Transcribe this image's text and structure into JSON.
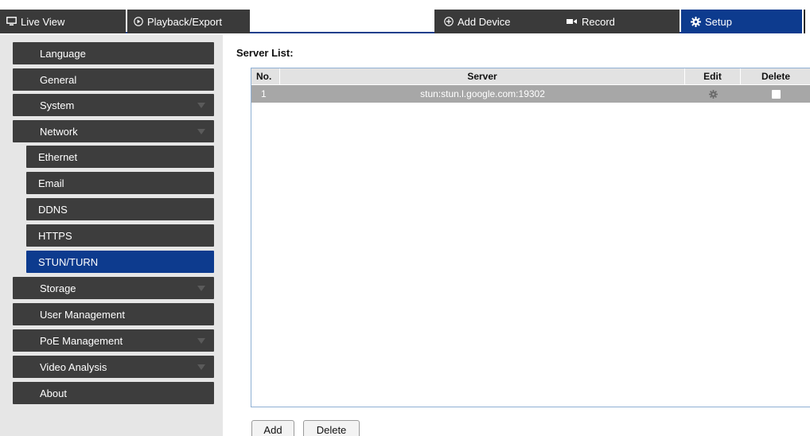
{
  "nav": {
    "live_view": "Live View",
    "playback": "Playback/Export",
    "add_device": "Add Device",
    "record": "Record",
    "setup": "Setup"
  },
  "sidebar": {
    "items": [
      {
        "label": "Language"
      },
      {
        "label": "General"
      },
      {
        "label": "System"
      },
      {
        "label": "Network"
      },
      {
        "label": "Ethernet"
      },
      {
        "label": "Email"
      },
      {
        "label": "DDNS"
      },
      {
        "label": "HTTPS"
      },
      {
        "label": "STUN/TURN"
      },
      {
        "label": "Storage"
      },
      {
        "label": "User Management"
      },
      {
        "label": "PoE Management"
      },
      {
        "label": "Video Analysis"
      },
      {
        "label": "About"
      }
    ]
  },
  "content": {
    "title": "Server List:",
    "columns": {
      "no": "No.",
      "server": "Server",
      "edit": "Edit",
      "delete": "Delete"
    },
    "rows": [
      {
        "no": "1",
        "server": "stun:stun.l.google.com:19302",
        "delete_checked": false
      }
    ],
    "add_button": "Add",
    "delete_button": "Delete"
  },
  "colors": {
    "accent": "#0d3b8e",
    "menu_bg": "#3d3d3d",
    "row_bg": "#a7a7a7"
  }
}
